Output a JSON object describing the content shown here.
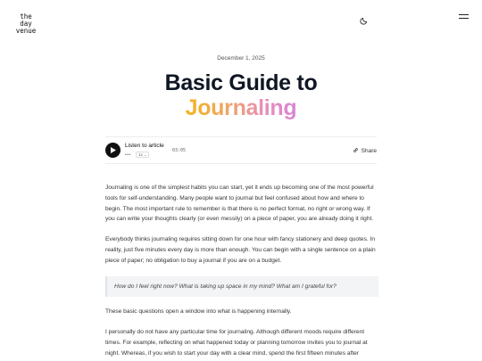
{
  "header": {
    "logo_lines": [
      "the",
      "day",
      "venue"
    ],
    "theme_icon": "moon-icon",
    "menu_icon": "hamburger-menu-icon"
  },
  "article": {
    "date": "December 1, 2025",
    "title_part1": "Basic Guide to",
    "title_part2": "Journaling",
    "gradient_colors": [
      "#f5b520",
      "#f0a55e",
      "#e88fb7",
      "#d884d6"
    ]
  },
  "player": {
    "label": "Listen to article",
    "dots": "•••",
    "speed": "1x",
    "duration": "03:05",
    "share_label": "Share"
  },
  "content": {
    "p1": "Journaling is one of the simplest habits you can start, yet it ends up becoming one of the most powerful tools for self-understanding. Many people want to journal but feel confused about how and where to begin. The most important rule to remember is that there is no perfect format, no right or wrong way. If you can write your thoughts clearly (or even messily) on a piece of paper, you are already doing it right.",
    "p2": "Everybody thinks journaling requires sitting down for one hour with fancy stationery and deep quotes. In reality, just five minutes every day is more than enough. You can begin with a single sentence on a plain piece of paper; no obligation to buy a journal if you are on a budget.",
    "quote": "How do I feel right now? What is taking up space in my mind? What am I grateful for?",
    "p3": "These basic questions open a window into what is happening internally.",
    "p4": "I personally do not have any particular time for journaling. Although different moods require different times. For example, reflecting on what happened today or planning tomorrow invites you to journal at night. Whereas, if you wish to start your day with a clear mind, spend the first fifteen minutes after waking up journaling instead of scrolling through your phone. Journaling"
  }
}
